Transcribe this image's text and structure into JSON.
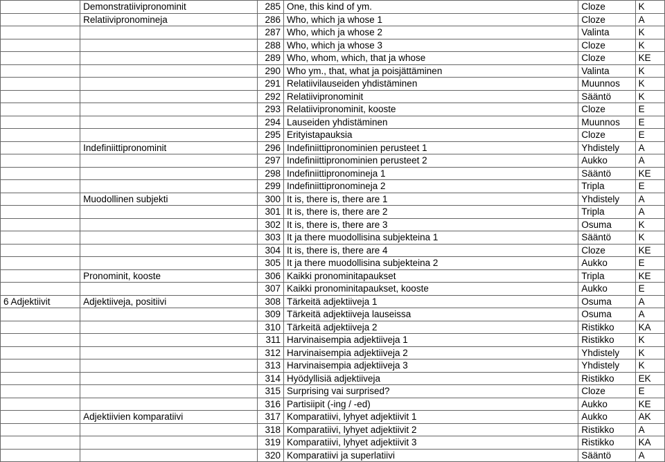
{
  "rows": [
    {
      "a": "",
      "b": "Demonstratiivipronominit",
      "c": 285,
      "d": "One, this kind of  ym.",
      "e": "Cloze",
      "f": "K"
    },
    {
      "a": "",
      "b": "Relatiivipronomineja",
      "c": 286,
      "d": "Who, which ja whose 1",
      "e": "Cloze",
      "f": "A"
    },
    {
      "a": "",
      "b": "",
      "c": 287,
      "d": "Who, which ja whose 2",
      "e": "Valinta",
      "f": "K"
    },
    {
      "a": "",
      "b": "",
      "c": 288,
      "d": "Who, which ja whose 3",
      "e": "Cloze",
      "f": "K"
    },
    {
      "a": "",
      "b": "",
      "c": 289,
      "d": "Who, whom, which, that ja whose",
      "e": "Cloze",
      "f": "KE"
    },
    {
      "a": "",
      "b": "",
      "c": 290,
      "d": "Who ym., that, what ja poisjättäminen",
      "e": "Valinta",
      "f": "K"
    },
    {
      "a": "",
      "b": "",
      "c": 291,
      "d": "Relatiivilauseiden yhdistäminen",
      "e": "Muunnos",
      "f": "K"
    },
    {
      "a": "",
      "b": "",
      "c": 292,
      "d": "Relatiivipronominit",
      "e": "Sääntö",
      "f": "K"
    },
    {
      "a": "",
      "b": "",
      "c": 293,
      "d": "Relatiivipronominit, kooste",
      "e": "Cloze",
      "f": "E"
    },
    {
      "a": "",
      "b": "",
      "c": 294,
      "d": "Lauseiden yhdistäminen",
      "e": "Muunnos",
      "f": "E"
    },
    {
      "a": "",
      "b": "",
      "c": 295,
      "d": "Erityistapauksia",
      "e": "Cloze",
      "f": "E"
    },
    {
      "a": "",
      "b": "Indefiniittipronominit",
      "c": 296,
      "d": "Indefiniittipronominien perusteet 1",
      "e": "Yhdistely",
      "f": "A"
    },
    {
      "a": "",
      "b": "",
      "c": 297,
      "d": "Indefiniittipronominien perusteet 2",
      "e": "Aukko",
      "f": "A"
    },
    {
      "a": "",
      "b": "",
      "c": 298,
      "d": "Indefiniittipronomineja 1",
      "e": "Sääntö",
      "f": "KE"
    },
    {
      "a": "",
      "b": "",
      "c": 299,
      "d": "Indefiniittipronomineja 2",
      "e": "Tripla",
      "f": "E"
    },
    {
      "a": "",
      "b": "Muodollinen subjekti",
      "c": 300,
      "d": "It is, there is, there are 1",
      "e": "Yhdistely",
      "f": "A"
    },
    {
      "a": "",
      "b": "",
      "c": 301,
      "d": "It is, there is, there are 2",
      "e": "Tripla",
      "f": "A"
    },
    {
      "a": "",
      "b": "",
      "c": 302,
      "d": "It is, there is, there are 3",
      "e": "Osuma",
      "f": "K"
    },
    {
      "a": "",
      "b": "",
      "c": 303,
      "d": "It ja there muodollisina subjekteina 1",
      "e": "Sääntö",
      "f": "K"
    },
    {
      "a": "",
      "b": "",
      "c": 304,
      "d": "It is, there is, there are 4",
      "e": "Cloze",
      "f": "KE"
    },
    {
      "a": "",
      "b": "",
      "c": 305,
      "d": "It ja there muodollisina subjekteina 2",
      "e": "Aukko",
      "f": "E"
    },
    {
      "a": "",
      "b": "Pronominit, kooste",
      "c": 306,
      "d": "Kaikki pronominitapaukset",
      "e": "Tripla",
      "f": "KE"
    },
    {
      "a": "",
      "b": "",
      "c": 307,
      "d": "Kaikki pronominitapaukset, kooste",
      "e": "Aukko",
      "f": "E"
    },
    {
      "a": "6 Adjektiivit",
      "b": "Adjektiiveja, positiivi",
      "c": 308,
      "d": "Tärkeitä adjektiiveja 1",
      "e": "Osuma",
      "f": "A"
    },
    {
      "a": "",
      "b": "",
      "c": 309,
      "d": "Tärkeitä adjektiiveja lauseissa",
      "e": "Osuma",
      "f": "A"
    },
    {
      "a": "",
      "b": "",
      "c": 310,
      "d": "Tärkeitä adjektiiveja 2",
      "e": "Ristikko",
      "f": "KA"
    },
    {
      "a": "",
      "b": "",
      "c": 311,
      "d": "Harvinaisempia adjektiiveja 1",
      "e": "Ristikko",
      "f": "K"
    },
    {
      "a": "",
      "b": "",
      "c": 312,
      "d": "Harvinaisempia adjektiiveja  2",
      "e": "Yhdistely",
      "f": "K"
    },
    {
      "a": "",
      "b": "",
      "c": 313,
      "d": "Harvinaisempia adjektiiveja  3",
      "e": "Yhdistely",
      "f": "K"
    },
    {
      "a": "",
      "b": "",
      "c": 314,
      "d": "Hyödyllisiä adjektiiveja",
      "e": "Ristikko",
      "f": "EK"
    },
    {
      "a": "",
      "b": "",
      "c": 315,
      "d": "Surprising vai surprised?",
      "e": "Cloze",
      "f": "E"
    },
    {
      "a": "",
      "b": "",
      "c": 316,
      "d": "Partisiipit (-ing / -ed)",
      "e": "Aukko",
      "f": "KE"
    },
    {
      "a": "",
      "b": "Adjektiivien komparatiivi",
      "c": 317,
      "d": "Komparatiivi, lyhyet adjektiivit 1",
      "e": "Aukko",
      "f": "AK"
    },
    {
      "a": "",
      "b": "",
      "c": 318,
      "d": "Komparatiivi, lyhyet adjektiivit 2",
      "e": "Ristikko",
      "f": "A"
    },
    {
      "a": "",
      "b": "",
      "c": 319,
      "d": "Komparatiivi, lyhyet adjektiivit 3",
      "e": "Ristikko",
      "f": "KA"
    },
    {
      "a": "",
      "b": "",
      "c": 320,
      "d": "Komparatiivi ja superlatiivi",
      "e": "Sääntö",
      "f": "A"
    }
  ]
}
